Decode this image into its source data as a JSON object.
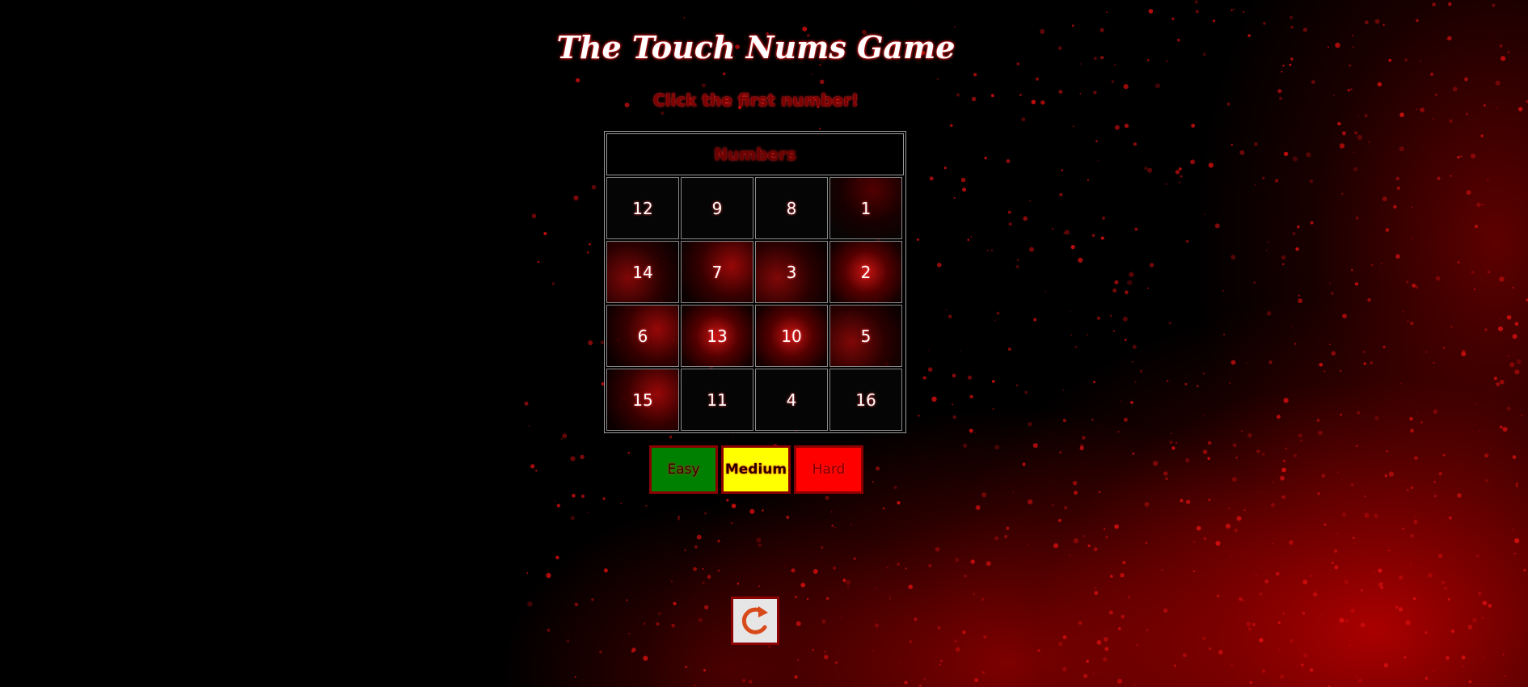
{
  "page": {
    "title": "The Touch Nums Game",
    "prompt": "Click the first number!"
  },
  "grid": {
    "header": "Numbers",
    "cells": [
      [
        "12",
        "9",
        "8",
        "1"
      ],
      [
        "14",
        "7",
        "3",
        "2"
      ],
      [
        "6",
        "13",
        "10",
        "5"
      ],
      [
        "15",
        "11",
        "4",
        "16"
      ]
    ]
  },
  "difficulty": {
    "easy": "Easy",
    "medium": "Medium",
    "hard": "Hard"
  },
  "reset": {
    "icon": "redo-icon"
  },
  "colors": {
    "background": "#000000",
    "accent": "#ff0000",
    "easy": "#008000",
    "medium": "#ffff00",
    "hard": "#ff0000",
    "button_border": "#8b0000"
  }
}
